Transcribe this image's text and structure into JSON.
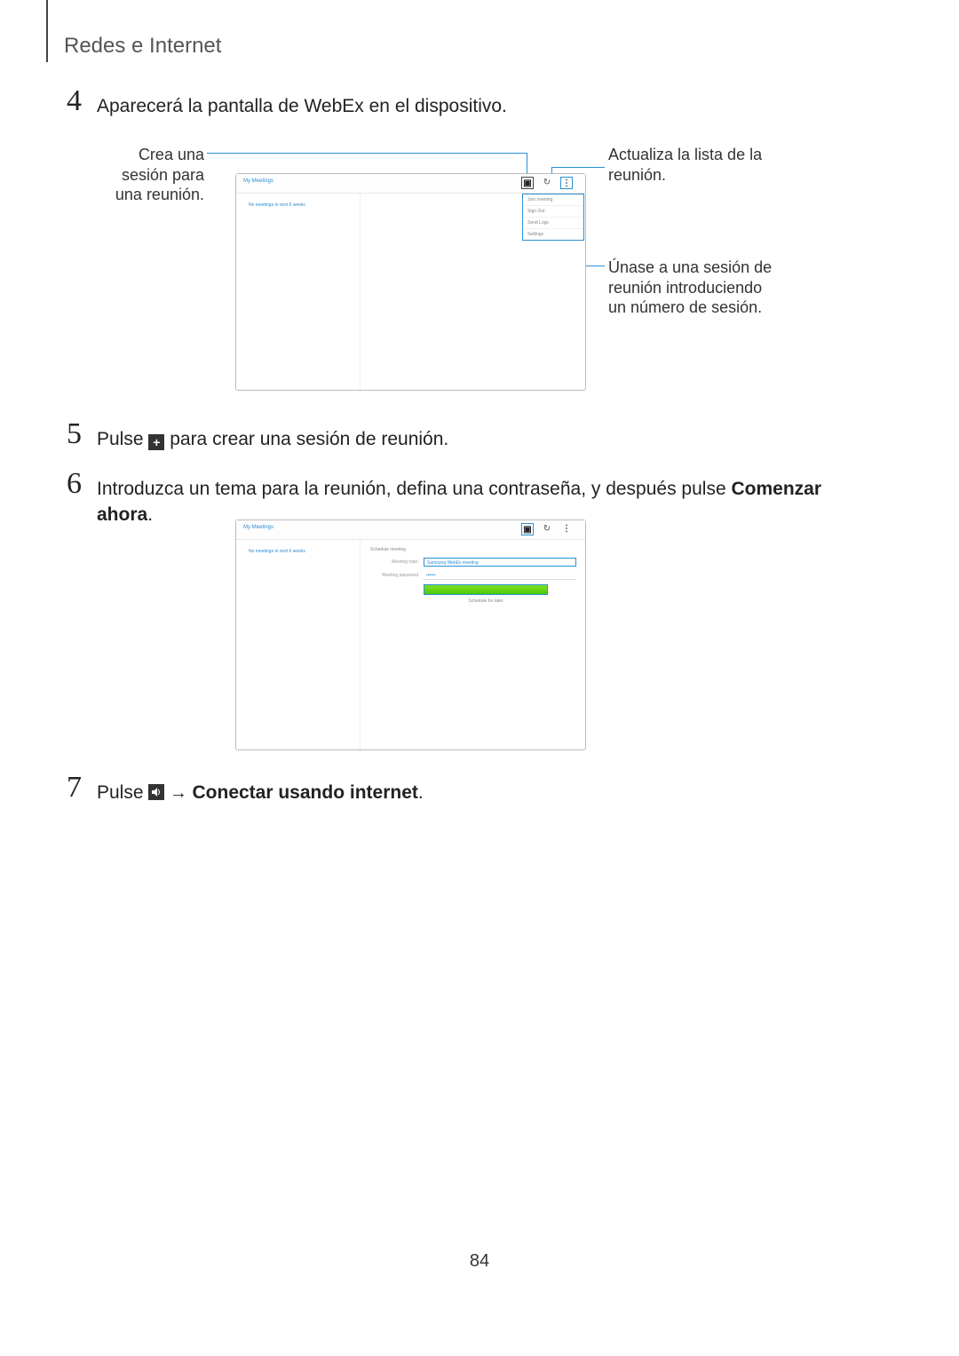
{
  "header": {
    "title": "Redes e Internet"
  },
  "steps": {
    "s4": {
      "num": "4",
      "text": "Aparecerá la pantalla de WebEx en el dispositivo."
    },
    "s5": {
      "num": "5",
      "pre": "Pulse ",
      "post": " para crear una sesión de reunión."
    },
    "s6": {
      "num": "6",
      "pre": "Introduzca un tema para la reunión, defina una contraseña, y después pulse ",
      "bold": "Comenzar ahora",
      "post": "."
    },
    "s7": {
      "num": "7",
      "pre": "Pulse ",
      "arrow": " → ",
      "bold": "Conectar usando internet",
      "post": "."
    }
  },
  "callouts": {
    "create": "Crea una sesión para\nuna reunión.",
    "refresh": "Actualiza la lista de la\nreunión.",
    "join": "Únase a una sesión de\nreunión introduciendo\nun número de sesión."
  },
  "mock1": {
    "title": "My Meetings",
    "empty": "No meetings in next 6 weeks",
    "menu": [
      "Join meeting",
      "Sign Out",
      "Send Logs",
      "Settings"
    ]
  },
  "mock2": {
    "title": "My Meetings",
    "empty": "No meetings in next 6 weeks",
    "panel_header": "Schedule meeting",
    "topic_label": "Meeting topic",
    "topic_value": "Samsung WebEx meeting",
    "pw_label": "Meeting password",
    "pw_value": "••••••",
    "schedule": "Schedule for later"
  },
  "icons": {
    "plus": "plus-icon",
    "refresh": "↻",
    "more": "⋮",
    "new_square": "▣"
  },
  "page_number": "84"
}
